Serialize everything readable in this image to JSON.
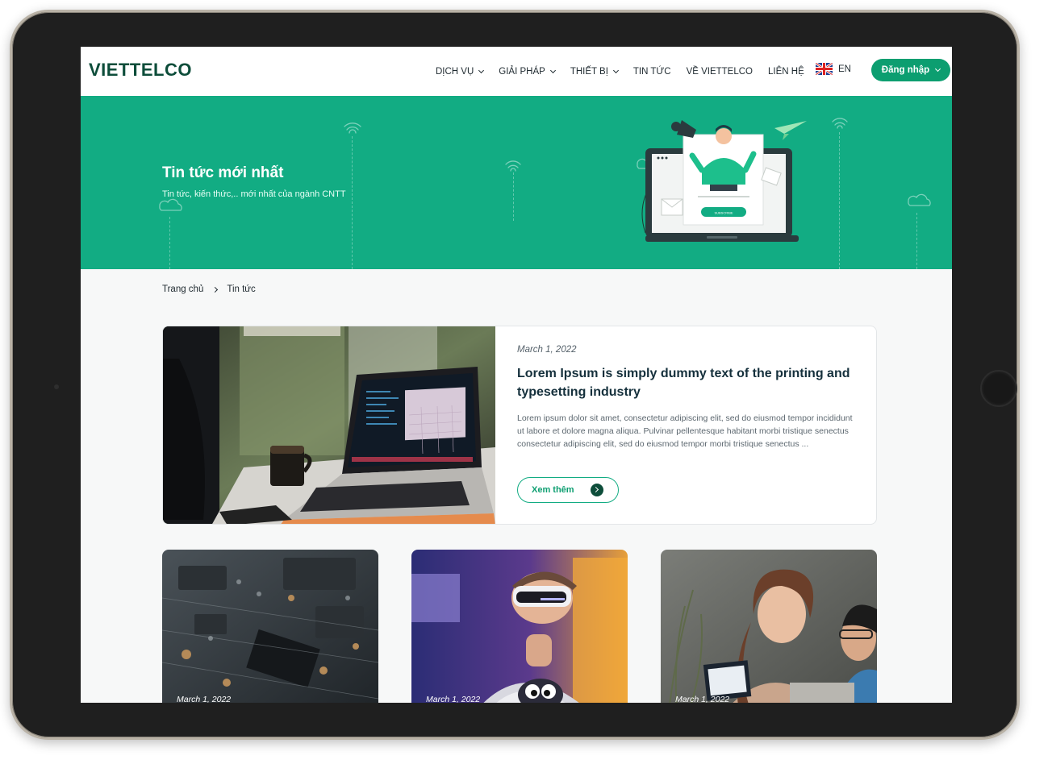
{
  "header": {
    "logo": "VIETTELCO",
    "nav": [
      {
        "label": "DỊCH VỤ",
        "has_dropdown": true
      },
      {
        "label": "GIẢI PHÁP",
        "has_dropdown": true
      },
      {
        "label": "THIẾT BỊ",
        "has_dropdown": true
      },
      {
        "label": "TIN TỨC",
        "has_dropdown": false
      },
      {
        "label": "VỀ VIETTELCO",
        "has_dropdown": false
      },
      {
        "label": "LIÊN HỆ",
        "has_dropdown": false
      }
    ],
    "language": {
      "label": "EN",
      "icon": "uk-flag-icon"
    },
    "login_label": "Đăng nhập"
  },
  "hero": {
    "title": "Tin tức mới nhất",
    "subtitle": "Tin tức, kiến thức,.. mới nhất của ngành CNTT",
    "illustration_button": "SUBSCRIBE"
  },
  "breadcrumb": {
    "home": "Trang chủ",
    "current": "Tin tức"
  },
  "featured": {
    "date": "March 1, 2022",
    "title": "Lorem Ipsum is simply dummy text of the printing and typesetting industry",
    "excerpt": "Lorem ipsum dolor sit amet, consectetur adipiscing elit, sed do eiusmod tempor incididunt ut labore et dolore magna aliqua. Pulvinar pellentesque habitant morbi tristique senectus consectetur adipiscing elit, sed do eiusmod tempor morbi tristique senectus ...",
    "more_label": "Xem thêm",
    "image": "laptop-on-desk-photo"
  },
  "cards": [
    {
      "date": "March 1, 2022",
      "image": "circuit-board-photo"
    },
    {
      "date": "March 1, 2022",
      "image": "vr-headset-photo"
    },
    {
      "date": "March 1, 2022",
      "image": "people-with-laptop-photo"
    }
  ],
  "colors": {
    "primary": "#12ac83",
    "button": "#0c9e70",
    "logo": "#0d4d3a",
    "title_text": "#15303c"
  }
}
